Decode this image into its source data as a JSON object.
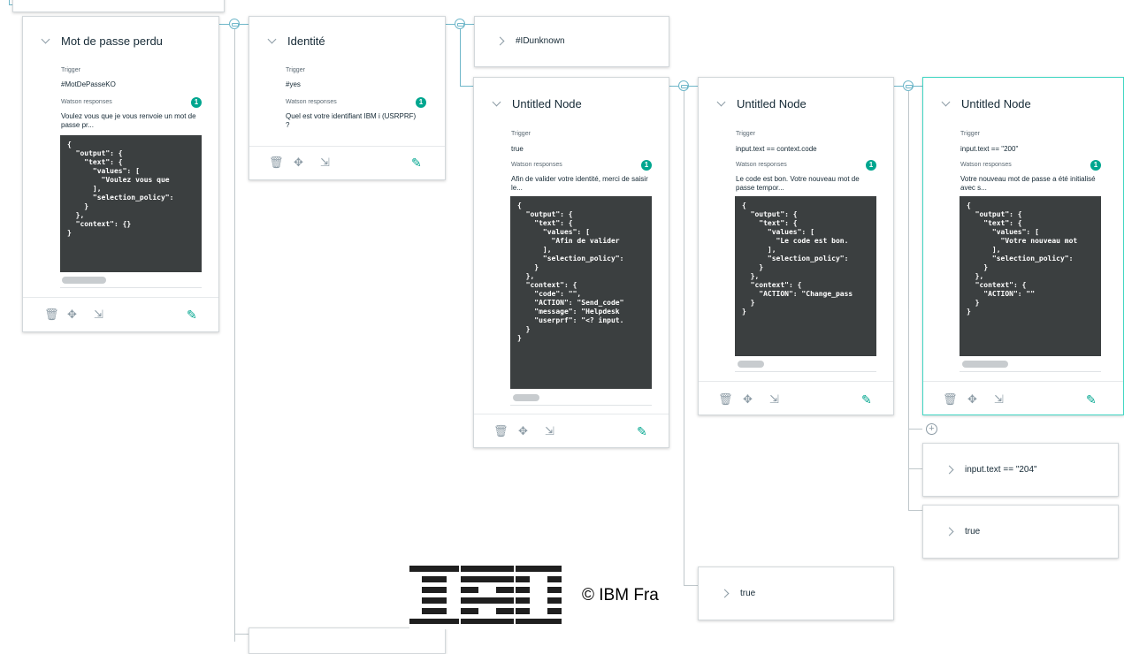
{
  "nodes": [
    {
      "title": "Mot de passe perdu",
      "trigger_label": "Trigger",
      "trigger": "#MotDePasseKO",
      "responses_label": "Watson responses",
      "badge": "1",
      "response": "Voulez vous que je vous renvoie un mot de passe pr...",
      "code": "{\n  \"output\": {\n    \"text\": {\n      \"values\": [\n        \"Voulez vous que\n      ],\n      \"selection_policy\":\n    }\n  },\n  \"context\": {}\n}"
    },
    {
      "title": "Identité",
      "trigger_label": "Trigger",
      "trigger": "#yes",
      "responses_label": "Watson responses",
      "badge": "1",
      "response": "Quel est votre identifiant IBM i (USRPRF) ?"
    },
    {
      "title": "Untitled Node",
      "trigger_label": "Trigger",
      "trigger": "true",
      "responses_label": "Watson responses",
      "badge": "1",
      "response": "Afin de valider votre identité, merci de saisir le...",
      "code": "{\n  \"output\": {\n    \"text\": {\n      \"values\": [\n        \"Afin de valider \n      ],\n      \"selection_policy\":\n    }\n  },\n  \"context\": {\n    \"code\": \"\",\n    \"ACTION\": \"Send_code\"\n    \"message\": \"Helpdesk\n    \"userprf\": \"<? input.\n  }\n}"
    },
    {
      "title": "Untitled Node",
      "trigger_label": "Trigger",
      "trigger": "input.text == context.code",
      "responses_label": "Watson responses",
      "badge": "1",
      "response": "Le code est bon. Votre nouveau mot de passe tempor...",
      "code": "{\n  \"output\": {\n    \"text\": {\n      \"values\": [\n        \"Le code est bon.\n      ],\n      \"selection_policy\":\n    }\n  },\n  \"context\": {\n    \"ACTION\": \"Change_pass\n  }\n}"
    },
    {
      "title": "Untitled Node",
      "trigger_label": "Trigger",
      "trigger": "input.text == \"200\"",
      "responses_label": "Watson responses",
      "badge": "1",
      "response": "Votre nouveau mot de passe a été initialisé avec s...",
      "code": "{\n  \"output\": {\n    \"text\": {\n      \"values\": [\n        \"Votre nouveau mot\n      ],\n      \"selection_policy\":\n    }\n  },\n  \"context\": {\n    \"ACTION\": \"\"\n  }\n}"
    }
  ],
  "collapsed": {
    "idunknown": "#IDunknown",
    "row_204": "input.text == \"204\"",
    "row_true_right": "true",
    "row_true_bottom": "true"
  },
  "footer": {
    "logo_text": "IBM",
    "copyright": "© IBM Fra"
  }
}
